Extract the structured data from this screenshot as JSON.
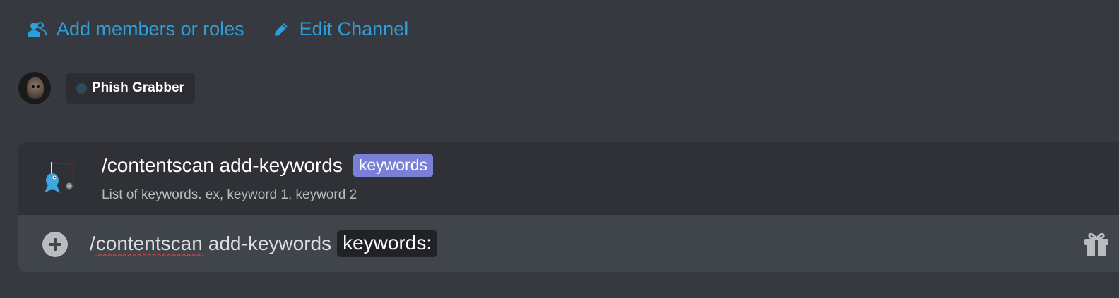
{
  "header": {
    "add_members_label": "Add members or roles",
    "edit_channel_label": "Edit Channel",
    "link_color": "#2e9fd8"
  },
  "members": [
    {
      "name": "Phish Grabber",
      "status_color": "#2c4a5a"
    }
  ],
  "autocomplete": {
    "command": "/contentscan add-keywords",
    "option_label": "keywords",
    "option_color": "#7a7fd8",
    "description": "List of keywords. ex, keyword 1, keyword 2"
  },
  "composer": {
    "slash": "/",
    "command": "contentscan",
    "subcommand": "add-keywords",
    "option_label": "keywords:"
  },
  "icons": [
    "members-icon",
    "pencil-icon",
    "fish-bot-icon",
    "add-attachment-icon",
    "gift-icon"
  ]
}
